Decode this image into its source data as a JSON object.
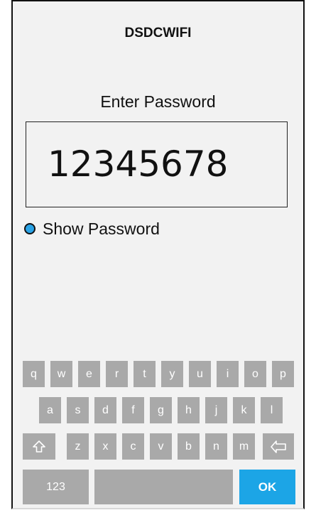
{
  "screen": {
    "network_name": "DSDCWIFI",
    "prompt": "Enter Password",
    "password_value": "12345678",
    "show_password_label": "Show Password",
    "show_password_selected": true,
    "radio_color": "#2aa3e6"
  },
  "keyboard": {
    "row1": [
      "q",
      "w",
      "e",
      "r",
      "t",
      "y",
      "u",
      "i",
      "o",
      "p"
    ],
    "row2": [
      "a",
      "s",
      "d",
      "f",
      "g",
      "h",
      "j",
      "k",
      "l"
    ],
    "row3": [
      "z",
      "x",
      "c",
      "v",
      "b",
      "n",
      "m"
    ],
    "shift_icon": "shift-arrow-icon",
    "backspace_icon": "backspace-icon",
    "numbers_label": "123",
    "ok_label": "OK",
    "key_color": "#a9a9a9",
    "ok_color": "#1ca5e6"
  }
}
